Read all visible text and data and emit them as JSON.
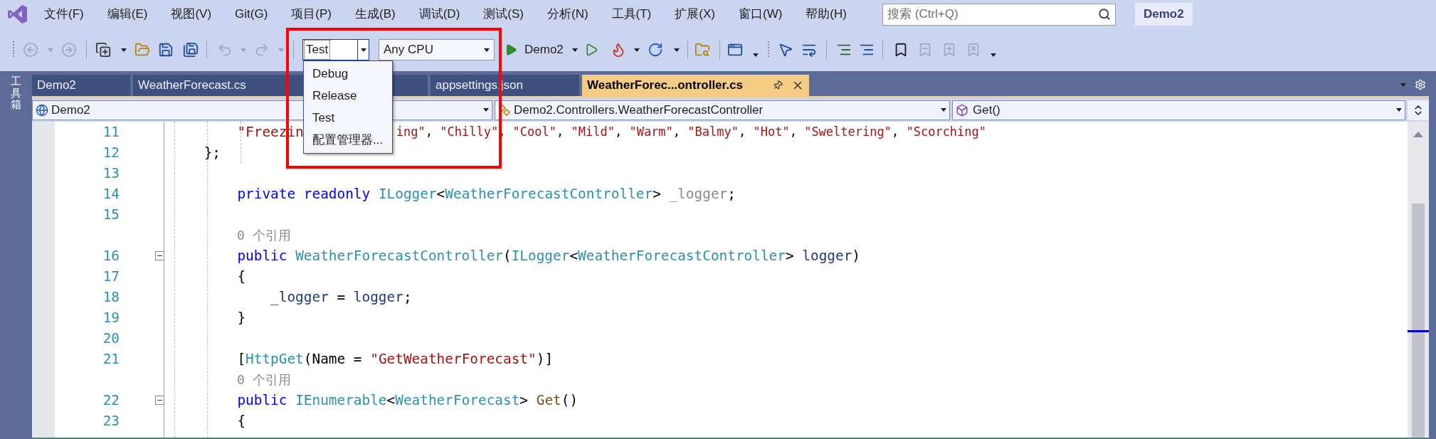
{
  "menu_bar": {
    "items": [
      "文件(F)",
      "编辑(E)",
      "视图(V)",
      "Git(G)",
      "项目(P)",
      "生成(B)",
      "调试(D)",
      "测试(S)",
      "分析(N)",
      "工具(T)",
      "扩展(X)",
      "窗口(W)",
      "帮助(H)"
    ],
    "search": {
      "placeholder": "搜索 (Ctrl+Q)"
    },
    "solution_name": "Demo2"
  },
  "toolbar": {
    "configuration": {
      "value": "Test",
      "expanded": true
    },
    "platform": "Any CPU",
    "start_target": "Demo2"
  },
  "configuration_menu": {
    "items": [
      "Debug",
      "Release",
      "Test",
      "配置管理器..."
    ]
  },
  "tool_window_strip": {
    "label": "工具箱"
  },
  "document_tabs": [
    {
      "label": "Demo2",
      "selected": false
    },
    {
      "label": "WeatherForecast.cs",
      "selected": false
    },
    {
      "label": "appsettings.json",
      "selected": false
    },
    {
      "label": "WeatherForec...ontroller.cs",
      "selected": true
    }
  ],
  "navigation_bar": {
    "project": "Demo2",
    "type": "Demo2.Controllers.WeatherForecastController",
    "member": "Get()"
  },
  "editor": {
    "lines": [
      {
        "kind": "code",
        "number": "11",
        "segments": [
          {
            "kind": "string",
            "text": "        \"Freezin"
          }
        ],
        "segments_after_menu": [
          {
            "kind": "string",
            "text": "ing\""
          },
          {
            "kind": "plain",
            "text": ", "
          },
          {
            "kind": "string",
            "text": "\"Chilly\""
          },
          {
            "kind": "plain",
            "text": ", "
          },
          {
            "kind": "string",
            "text": "\"Cool\""
          },
          {
            "kind": "plain",
            "text": ", "
          },
          {
            "kind": "string",
            "text": "\"Mild\""
          },
          {
            "kind": "plain",
            "text": ", "
          },
          {
            "kind": "string",
            "text": "\"Warm\""
          },
          {
            "kind": "plain",
            "text": ", "
          },
          {
            "kind": "string",
            "text": "\"Balmy\""
          },
          {
            "kind": "plain",
            "text": ", "
          },
          {
            "kind": "string",
            "text": "\"Hot\""
          },
          {
            "kind": "plain",
            "text": ", "
          },
          {
            "kind": "string",
            "text": "\"Sweltering\""
          },
          {
            "kind": "plain",
            "text": ", "
          },
          {
            "kind": "string",
            "text": "\"Scorching\""
          }
        ]
      },
      {
        "kind": "code",
        "number": "12",
        "segments": [
          {
            "kind": "plain",
            "text": "    };"
          }
        ]
      },
      {
        "kind": "code",
        "number": "13"
      },
      {
        "kind": "code",
        "number": "14",
        "segments": [
          {
            "kind": "keyword",
            "text": "        private "
          },
          {
            "kind": "keyword",
            "text": "readonly "
          },
          {
            "kind": "type",
            "text": "ILogger"
          },
          {
            "kind": "plain",
            "text": "<"
          },
          {
            "kind": "type",
            "text": "WeatherForecastController"
          },
          {
            "kind": "plain",
            "text": "> "
          },
          {
            "kind": "unused",
            "text": "_logger"
          },
          {
            "kind": "plain",
            "text": ";"
          }
        ]
      },
      {
        "kind": "code",
        "number": "15"
      },
      {
        "kind": "lens",
        "text": "0 个引用"
      },
      {
        "kind": "code",
        "number": "16",
        "fold": {
          "expanded": true
        },
        "segments": [
          {
            "kind": "keyword",
            "text": "        public "
          },
          {
            "kind": "type",
            "text": "WeatherForecastController"
          },
          {
            "kind": "plain",
            "text": "("
          },
          {
            "kind": "type",
            "text": "ILogger"
          },
          {
            "kind": "plain",
            "text": "<"
          },
          {
            "kind": "type",
            "text": "WeatherForecastController"
          },
          {
            "kind": "plain",
            "text": "> "
          },
          {
            "kind": "param",
            "text": "logger"
          },
          {
            "kind": "plain",
            "text": ")"
          }
        ]
      },
      {
        "kind": "code",
        "number": "17",
        "segments": [
          {
            "kind": "plain",
            "text": "        {"
          }
        ]
      },
      {
        "kind": "code",
        "number": "18",
        "segments": [
          {
            "kind": "param",
            "text": "            _logger"
          },
          {
            "kind": "plain",
            "text": " = "
          },
          {
            "kind": "param",
            "text": "logger"
          },
          {
            "kind": "plain",
            "text": ";"
          }
        ]
      },
      {
        "kind": "code",
        "number": "19",
        "segments": [
          {
            "kind": "plain",
            "text": "        }"
          }
        ]
      },
      {
        "kind": "code",
        "number": "20"
      },
      {
        "kind": "code",
        "number": "21",
        "segments": [
          {
            "kind": "plain",
            "text": "        ["
          },
          {
            "kind": "type",
            "text": "HttpGet"
          },
          {
            "kind": "plain",
            "text": "(Name = "
          },
          {
            "kind": "string",
            "text": "\"GetWeatherForecast\""
          },
          {
            "kind": "plain",
            "text": ")]"
          }
        ]
      },
      {
        "kind": "lens",
        "text": "0 个引用"
      },
      {
        "kind": "code",
        "number": "22",
        "fold": {
          "expanded": true
        },
        "segments": [
          {
            "kind": "keyword",
            "text": "        public "
          },
          {
            "kind": "type",
            "text": "IEnumerable"
          },
          {
            "kind": "plain",
            "text": "<"
          },
          {
            "kind": "type",
            "text": "WeatherForecast"
          },
          {
            "kind": "plain",
            "text": "> "
          },
          {
            "kind": "method",
            "text": "Get"
          },
          {
            "kind": "plain",
            "text": "()"
          }
        ]
      },
      {
        "kind": "code",
        "number": "23",
        "segments": [
          {
            "kind": "plain",
            "text": "        {"
          }
        ]
      }
    ]
  }
}
